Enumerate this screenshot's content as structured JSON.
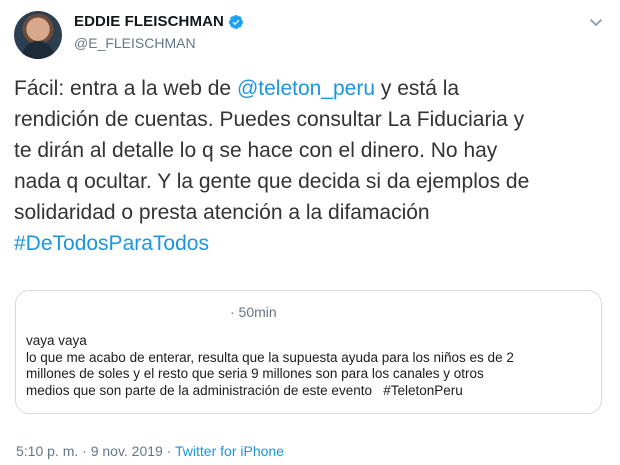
{
  "author": {
    "display_name": "EDDIE FLEISCHMAN",
    "handle": "@E_FLEISCHMAN",
    "verified": true
  },
  "tweet": {
    "text_line1_a": "Fácil: entra a la web de ",
    "mention": "@teleton_peru",
    "text_line1_b": " y está la\nrendición de cuentas. Puedes consultar La Fiduciaria y\nte dirán al detalle lo q se hace con el dinero. No hay\nnada q ocultar. Y la gente que decida si da ejemplos de\nsolidaridad o presta atención a la difamación\n",
    "hashtag": "#DeTodosParaTodos"
  },
  "quoted": {
    "time": "· 50min",
    "text": "vaya vaya\nlo que me acabo de enterar, resulta que la supuesta ayuda para los niños es de 2\nmillones de soles y el resto que seria 9 millones son para los canales y otros\nmedios que son parte de la administración de este evento   #TeletonPeru"
  },
  "meta": {
    "timestamp": "5:10 p. m. · 9 nov. 2019 · ",
    "source": "Twitter for iPhone"
  },
  "colors": {
    "link": "#1b95e0",
    "verified": "#1da1f2",
    "secondary_text": "#657786"
  },
  "icons": {
    "verified": "verified-badge-icon",
    "more": "chevron-down-icon"
  }
}
